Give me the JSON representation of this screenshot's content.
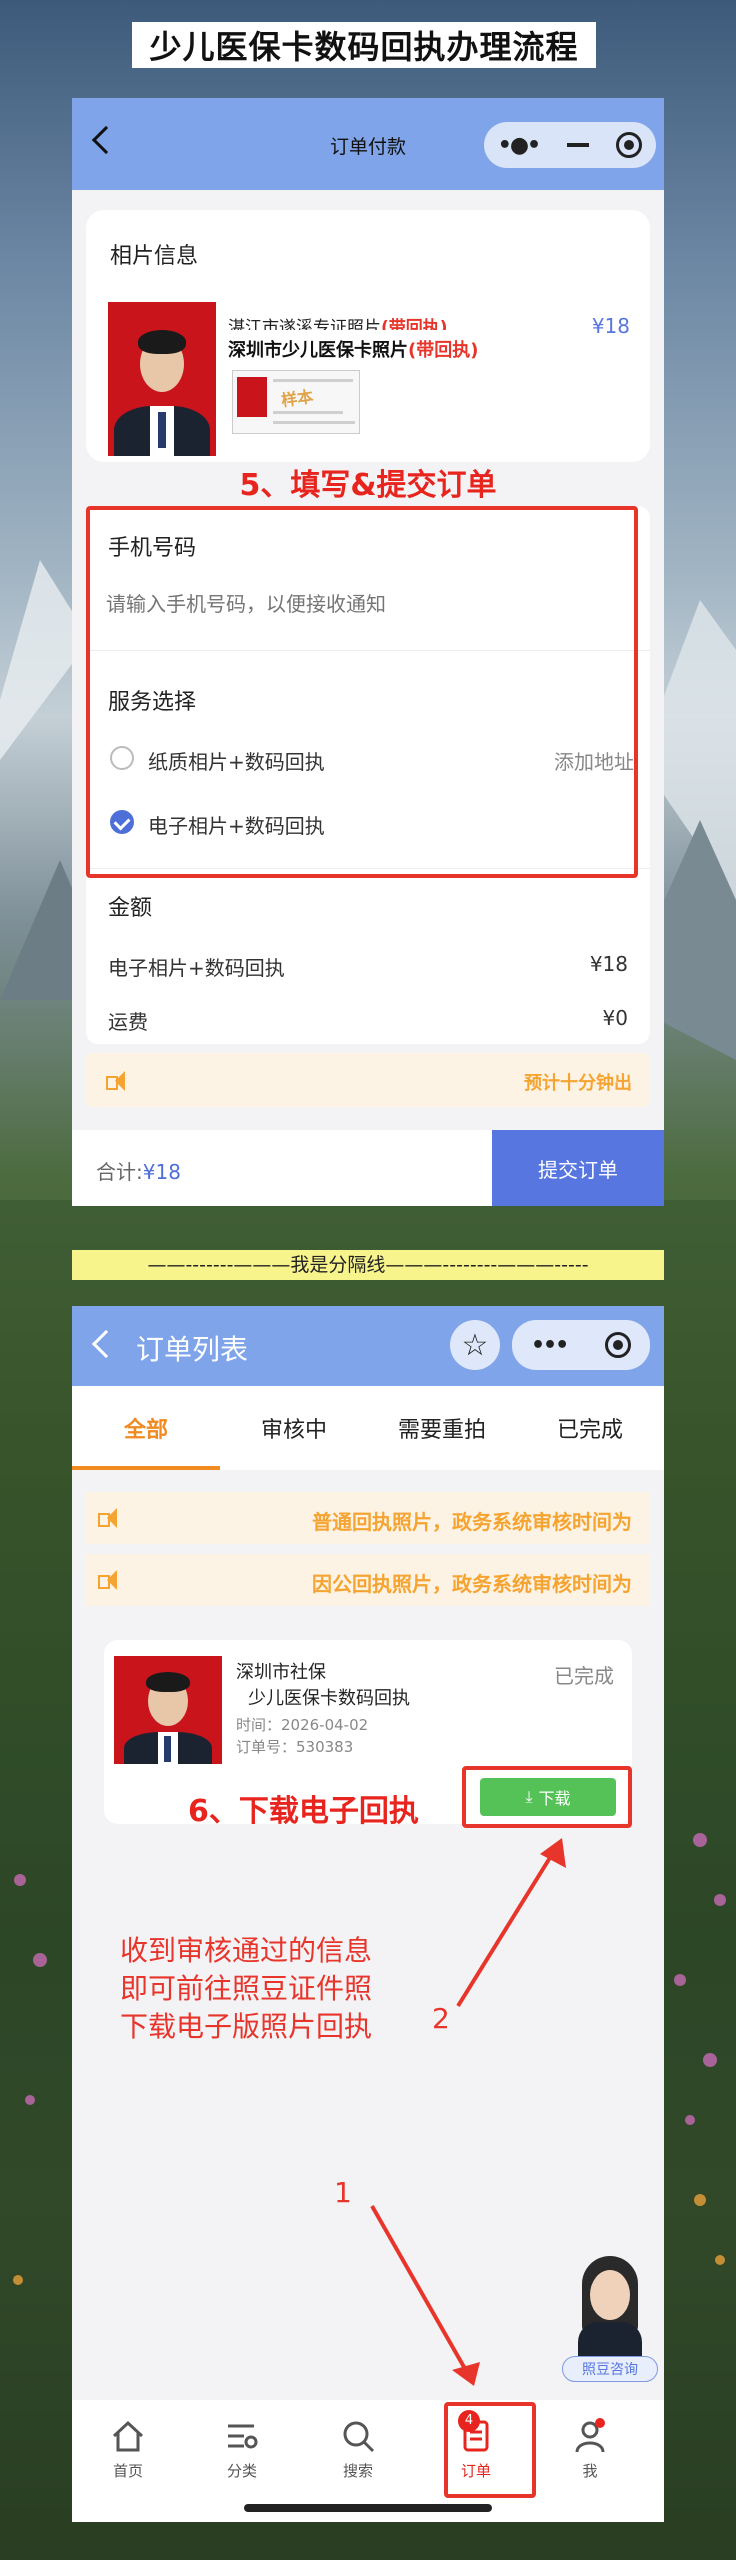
{
  "banner_title": "少儿医保卡数码回执办理流程",
  "screen1": {
    "nav_title": "订单付款",
    "photo_section_title": "相片信息",
    "photo_name_overlap": "湛江市遂溪专证照片",
    "photo_name_overlap_tag": "(带回执)",
    "photo_name": "深圳市少儿医保卡照片",
    "photo_tag": "(带回执)",
    "photo_price": "¥18",
    "sample_stamp": "样本",
    "step5_label": "5、填写&提交订单",
    "phone_title": "手机号码",
    "phone_placeholder": "请输入手机号码，以便接收通知",
    "service_title": "服务选择",
    "options": [
      {
        "label": "纸质相片+数码回执",
        "extra": "添加地址",
        "selected": false
      },
      {
        "label": "电子相片+数码回执",
        "extra": "",
        "selected": true
      }
    ],
    "amount_title": "金额",
    "amount_rows": [
      {
        "label": "电子相片+数码回执",
        "value": "¥18"
      },
      {
        "label": "运费",
        "value": "¥0"
      }
    ],
    "notice_text": "预计十分钟出",
    "total_label": "合计:",
    "total_value": "¥18",
    "submit_label": "提交订单"
  },
  "divider_text": "——-------———我是分隔线———--------———-----",
  "screen2": {
    "nav_title": "订单列表",
    "tabs": [
      "全部",
      "审核中",
      "需要重拍",
      "已完成"
    ],
    "active_tab": "全部",
    "notices": [
      "普通回执照片，政务系统审核时间为",
      "因公回执照片，政务系统审核时间为"
    ],
    "order": {
      "title_line1": "深圳市社保",
      "title_line2": "少儿医保卡数码回执",
      "status": "已完成",
      "time": "时间：2026-04-02",
      "order_no": "订单号：530383",
      "download_label": "下载"
    },
    "step6_label": "6、下载电子回执",
    "instructions": [
      "收到审核通过的信息",
      "即可前往照豆证件照",
      "下载电子版照片回执"
    ],
    "marker1": "1",
    "marker2": "2",
    "consult_label": "照豆咨询",
    "tabbar": [
      {
        "label": "首页",
        "icon": "home-icon"
      },
      {
        "label": "分类",
        "icon": "category-icon"
      },
      {
        "label": "搜索",
        "icon": "search-icon"
      },
      {
        "label": "订单",
        "icon": "order-icon",
        "badge": "4",
        "active": true
      },
      {
        "label": "我",
        "icon": "profile-icon"
      }
    ]
  },
  "colors": {
    "accent": "#5776e0",
    "nav": "#7fa4e9",
    "alert_red": "#e8352b",
    "notice_orange": "#f5a432",
    "tab_orange": "#f08a21"
  }
}
